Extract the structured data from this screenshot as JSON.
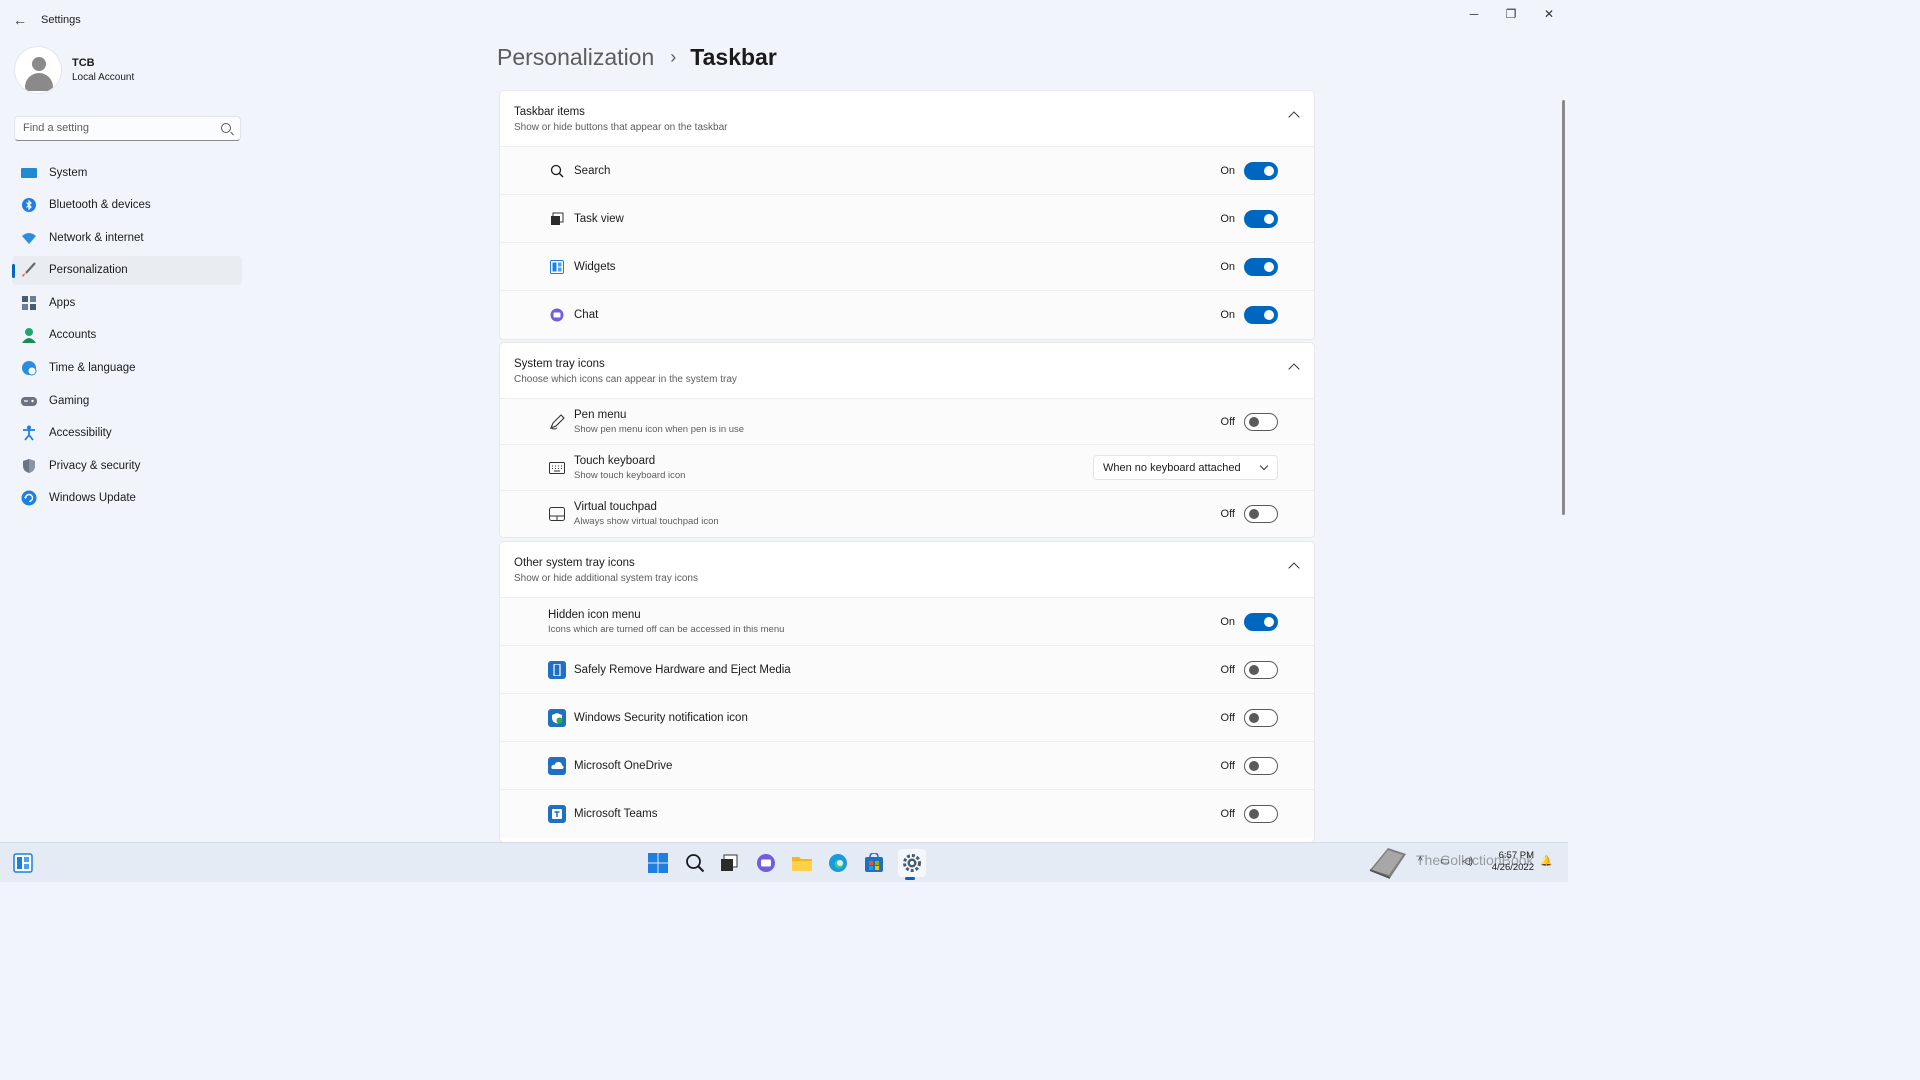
{
  "window": {
    "title": "Settings",
    "minimize": "─",
    "maximize": "❐",
    "close": "✕",
    "back": "←"
  },
  "profile": {
    "name": "TCB",
    "account_type": "Local Account"
  },
  "search": {
    "placeholder": "Find a setting"
  },
  "nav": [
    {
      "label": "System",
      "icon": "system-icon",
      "color": "#1f8ad2"
    },
    {
      "label": "Bluetooth & devices",
      "icon": "bluetooth-icon",
      "color": "#1f7fe0"
    },
    {
      "label": "Network & internet",
      "icon": "wifi-icon",
      "color": "#2a8ee0"
    },
    {
      "label": "Personalization",
      "icon": "brush-icon",
      "color": "#e06b2a",
      "active": true
    },
    {
      "label": "Apps",
      "icon": "apps-icon",
      "color": "#4b5b70"
    },
    {
      "label": "Accounts",
      "icon": "accounts-icon",
      "color": "#23a46b"
    },
    {
      "label": "Time & language",
      "icon": "globe-clock-icon",
      "color": "#2a8ee0"
    },
    {
      "label": "Gaming",
      "icon": "gamepad-icon",
      "color": "#6b7280"
    },
    {
      "label": "Accessibility",
      "icon": "accessibility-icon",
      "color": "#1f7fe0"
    },
    {
      "label": "Privacy & security",
      "icon": "shield-icon",
      "color": "#6b7280"
    },
    {
      "label": "Windows Update",
      "icon": "update-icon",
      "color": "#1f7fe0"
    }
  ],
  "breadcrumb": {
    "parent": "Personalization",
    "separator": "›",
    "current": "Taskbar"
  },
  "sections": {
    "taskbar_items": {
      "title": "Taskbar items",
      "subtitle": "Show or hide buttons that appear on the taskbar",
      "rows": [
        {
          "label": "Search",
          "state": "On",
          "on": true,
          "icon": "search-icon"
        },
        {
          "label": "Task view",
          "state": "On",
          "on": true,
          "icon": "task-view-icon"
        },
        {
          "label": "Widgets",
          "state": "On",
          "on": true,
          "icon": "widgets-icon"
        },
        {
          "label": "Chat",
          "state": "On",
          "on": true,
          "icon": "chat-icon"
        }
      ]
    },
    "system_tray": {
      "title": "System tray icons",
      "subtitle": "Choose which icons can appear in the system tray",
      "pen": {
        "label": "Pen menu",
        "sub": "Show pen menu icon when pen is in use",
        "state": "Off"
      },
      "touch": {
        "label": "Touch keyboard",
        "sub": "Show touch keyboard icon",
        "value": "When no keyboard attached"
      },
      "touchpad": {
        "label": "Virtual touchpad",
        "sub": "Always show virtual touchpad icon",
        "state": "Off"
      }
    },
    "other_tray": {
      "title": "Other system tray icons",
      "subtitle": "Show or hide additional system tray icons",
      "hidden": {
        "label": "Hidden icon menu",
        "sub": "Icons which are turned off can be accessed in this menu",
        "state": "On"
      },
      "rows": [
        {
          "label": "Safely Remove Hardware and Eject Media",
          "state": "Off",
          "icon": "usb-eject-icon"
        },
        {
          "label": "Windows Security notification icon",
          "state": "Off",
          "icon": "windows-security-icon"
        },
        {
          "label": "Microsoft OneDrive",
          "state": "Off",
          "icon": "onedrive-icon"
        },
        {
          "label": "Microsoft Teams",
          "state": "Off",
          "icon": "teams-icon"
        }
      ]
    }
  },
  "taskbar": {
    "time": "6:57 PM",
    "date": "4/26/2022",
    "watermark": "TheCollectionBook"
  },
  "colors": {
    "accent": "#0067c0",
    "background": "#f1f5fb"
  }
}
